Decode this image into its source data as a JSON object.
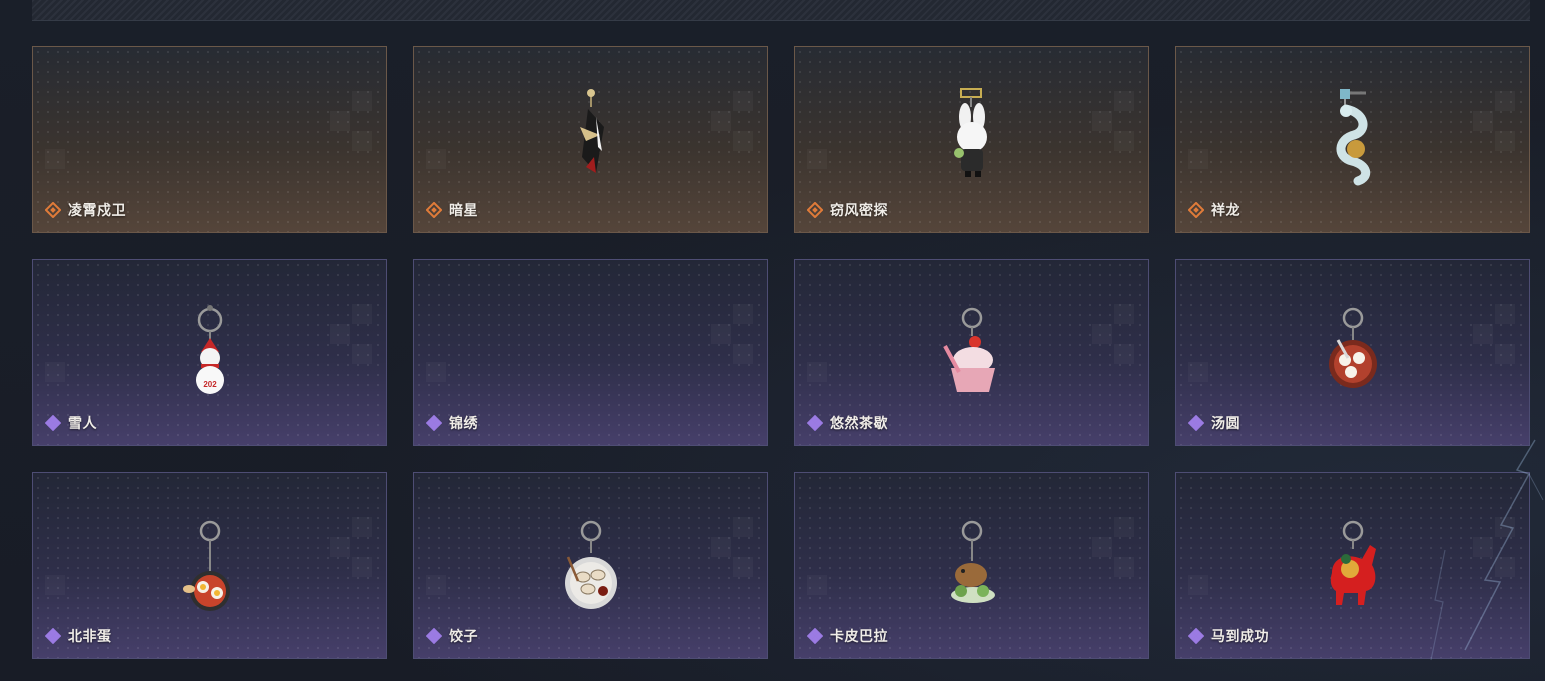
{
  "colors": {
    "orange_rarity": "#e07b39",
    "purple_rarity": "#9b7be3",
    "background": "#171b24"
  },
  "items": [
    {
      "name": "凌霄戍卫",
      "rarity": "orange",
      "charm": "none"
    },
    {
      "name": "暗星",
      "rarity": "orange",
      "charm": "dark-star-charm"
    },
    {
      "name": "窃风密探",
      "rarity": "orange",
      "charm": "rabbit-spy-charm"
    },
    {
      "name": "祥龙",
      "rarity": "orange",
      "charm": "dragon-charm"
    },
    {
      "name": "雪人",
      "rarity": "purple",
      "charm": "snowman-charm"
    },
    {
      "name": "锦绣",
      "rarity": "purple",
      "charm": "none"
    },
    {
      "name": "悠然茶歇",
      "rarity": "purple",
      "charm": "cupcake-charm"
    },
    {
      "name": "汤圆",
      "rarity": "purple",
      "charm": "tangyuan-charm"
    },
    {
      "name": "北非蛋",
      "rarity": "purple",
      "charm": "shakshuka-charm"
    },
    {
      "name": "饺子",
      "rarity": "purple",
      "charm": "dumpling-charm"
    },
    {
      "name": "卡皮巴拉",
      "rarity": "purple",
      "charm": "capybara-charm"
    },
    {
      "name": "马到成功",
      "rarity": "purple",
      "charm": "red-horse-charm"
    }
  ]
}
